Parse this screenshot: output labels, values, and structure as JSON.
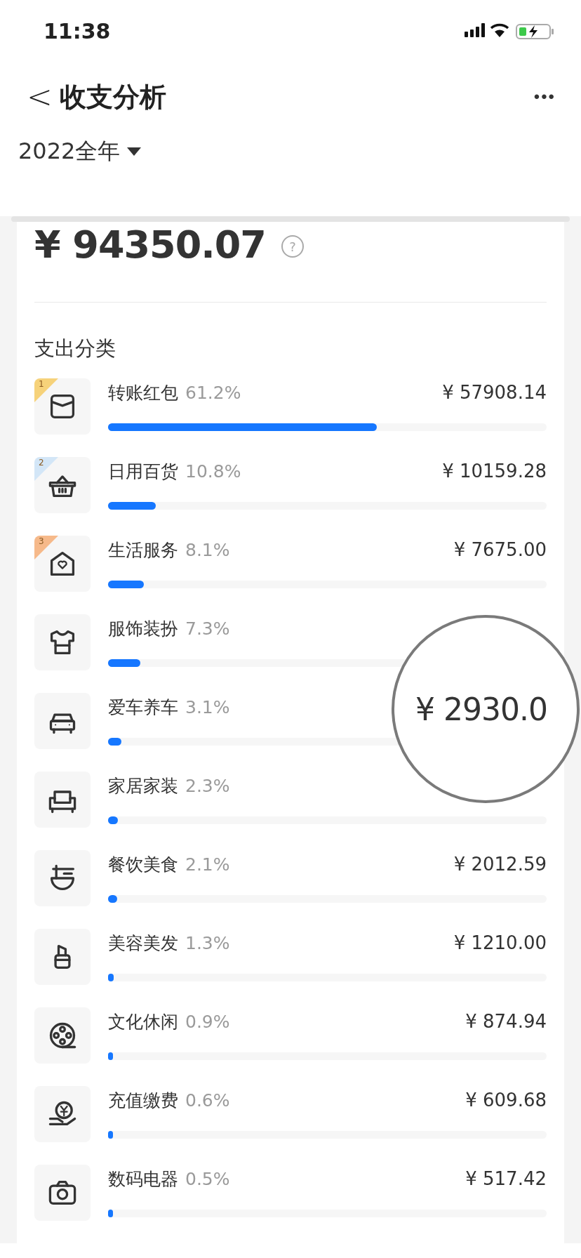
{
  "status_bar": {
    "time": "11:38"
  },
  "header": {
    "back": "<",
    "title": "收支分析",
    "more": "•••"
  },
  "period": {
    "label": "2022全年"
  },
  "summary": {
    "amount": "¥ 94350.07",
    "help": "?"
  },
  "section_title": "支出分类",
  "categories": [
    {
      "name": "转账红包",
      "percent": "61.2%",
      "amount": "¥ 57908.14",
      "level": 0.612,
      "rank": "1",
      "color": "#f6d27a"
    },
    {
      "name": "日用百货",
      "percent": "10.8%",
      "amount": "¥ 10159.28",
      "level": 0.108,
      "rank": "2",
      "color": "#d3e6f7"
    },
    {
      "name": "生活服务",
      "percent": "8.1%",
      "amount": "¥ 7675.00",
      "level": 0.081,
      "rank": "3",
      "color": "#f6b98a"
    },
    {
      "name": "服饰装扮",
      "percent": "7.3%",
      "level": 0.073
    },
    {
      "name": "爱车养车",
      "percent": "3.1%",
      "level": 0.031
    },
    {
      "name": "家居家装",
      "percent": "2.3%",
      "level": 0.023
    },
    {
      "name": "餐饮美食",
      "percent": "2.1%",
      "amount": "¥ 2012.59",
      "level": 0.021
    },
    {
      "name": "美容美发",
      "percent": "1.3%",
      "amount": "¥ 1210.00",
      "level": 0.013
    },
    {
      "name": "文化休闲",
      "percent": "0.9%",
      "amount": "¥ 874.94",
      "level": 0.009
    },
    {
      "name": "充值缴费",
      "percent": "0.6%",
      "amount": "¥ 609.68",
      "level": 0.006
    },
    {
      "name": "数码电器",
      "percent": "0.5%",
      "amount": "¥ 517.42",
      "level": 0.005
    }
  ],
  "magnifier": {
    "text": "¥ 2930.0"
  }
}
